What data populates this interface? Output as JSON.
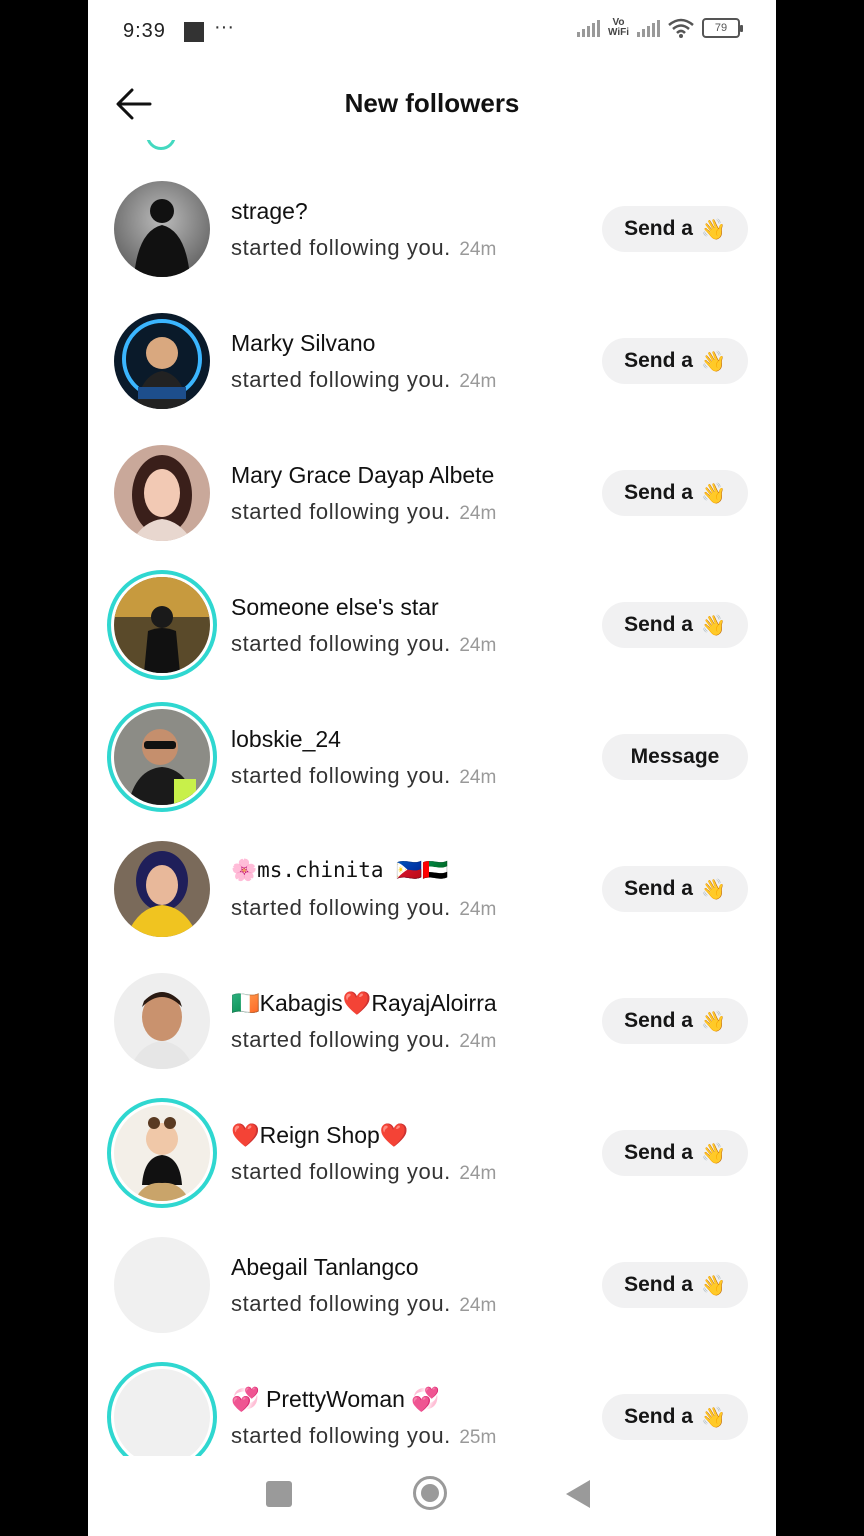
{
  "status_bar": {
    "time": "9:39",
    "dots": "···",
    "vowifi_top": "Vo",
    "vowifi_bottom": "WiFi",
    "battery": "79"
  },
  "header": {
    "title": "New followers",
    "back_icon": "arrow-left-icon"
  },
  "followers": [
    {
      "name": "strage?",
      "subtitle": "started following you.",
      "time": "24m",
      "action": "Send a",
      "action_icon": "👋"
    },
    {
      "name": "Marky Silvano",
      "subtitle": "started following you.",
      "time": "24m",
      "action": "Send a",
      "action_icon": "👋"
    },
    {
      "name": "Mary Grace Dayap Albete",
      "subtitle": "started following you.",
      "time": "24m",
      "action": "Send a",
      "action_icon": "👋"
    },
    {
      "name": "Someone else's star",
      "subtitle": "started following you.",
      "time": "24m",
      "action": "Send a",
      "action_icon": "👋"
    },
    {
      "name": "lobskie_24",
      "subtitle": "started following you.",
      "time": "24m",
      "action": "Message",
      "action_icon": ""
    },
    {
      "name": "🌸ms.chinita 🇵🇭🇦🇪",
      "subtitle": "started following you.",
      "time": "24m",
      "action": "Send a",
      "action_icon": "👋"
    },
    {
      "name": "🇮🇪Kabagis❤️RayajAloirra",
      "subtitle": "started following you.",
      "time": "24m",
      "action": "Send a",
      "action_icon": "👋"
    },
    {
      "name": "❤️Reign Shop❤️",
      "subtitle": "started following you.",
      "time": "24m",
      "action": "Send a",
      "action_icon": "👋"
    },
    {
      "name": "Abegail Tanlangco",
      "subtitle": "started following you.",
      "time": "24m",
      "action": "Send a",
      "action_icon": "👋"
    },
    {
      "name": "💞 PrettyWoman 💞",
      "subtitle": "started following you.",
      "time": "25m",
      "action": "Send a",
      "action_icon": "👋"
    }
  ],
  "colors": {
    "story_ring": "#2fd7d0",
    "button_bg": "#f1f1f2"
  },
  "nav_bar": {
    "recents_icon": "square-icon",
    "home_icon": "circle-home-icon",
    "back_icon": "triangle-back-icon"
  }
}
